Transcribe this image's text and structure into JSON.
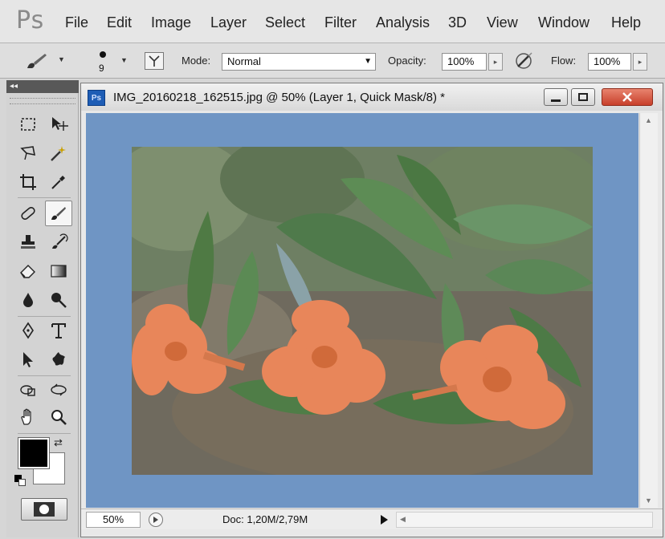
{
  "app": {
    "logo": "Ps"
  },
  "menu": [
    "File",
    "Edit",
    "Image",
    "Layer",
    "Select",
    "Filter",
    "Analysis",
    "3D",
    "View",
    "Window",
    "Help"
  ],
  "options": {
    "brush_size": "9",
    "mode_label": "Mode:",
    "mode_value": "Normal",
    "opacity_label": "Opacity:",
    "opacity_value": "100%",
    "flow_label": "Flow:",
    "flow_value": "100%"
  },
  "toolbox": {
    "collapse": "◂◂",
    "tools": [
      "marquee-tool",
      "move-tool",
      "lasso-tool",
      "magic-wand-tool",
      "crop-tool",
      "eyedropper-tool",
      "spot-healing-tool",
      "brush-tool",
      "clone-stamp-tool",
      "history-brush-tool",
      "eraser-tool",
      "gradient-tool",
      "blur-tool",
      "dodge-tool",
      "pen-tool",
      "type-tool",
      "path-selection-tool",
      "shape-tool",
      "3d-rotate-tool",
      "3d-orbit-tool",
      "hand-tool",
      "zoom-tool"
    ],
    "active_tool": "brush-tool",
    "foreground_color": "#000000",
    "background_color": "#ffffff"
  },
  "document": {
    "icon": "Ps",
    "title": "IMG_20160218_162515.jpg @ 50% (Layer 1, Quick Mask/8) *",
    "zoom": "50%",
    "doc_info": "Doc: 1,20M/2,79M",
    "mask_color": "#6f95c4"
  }
}
